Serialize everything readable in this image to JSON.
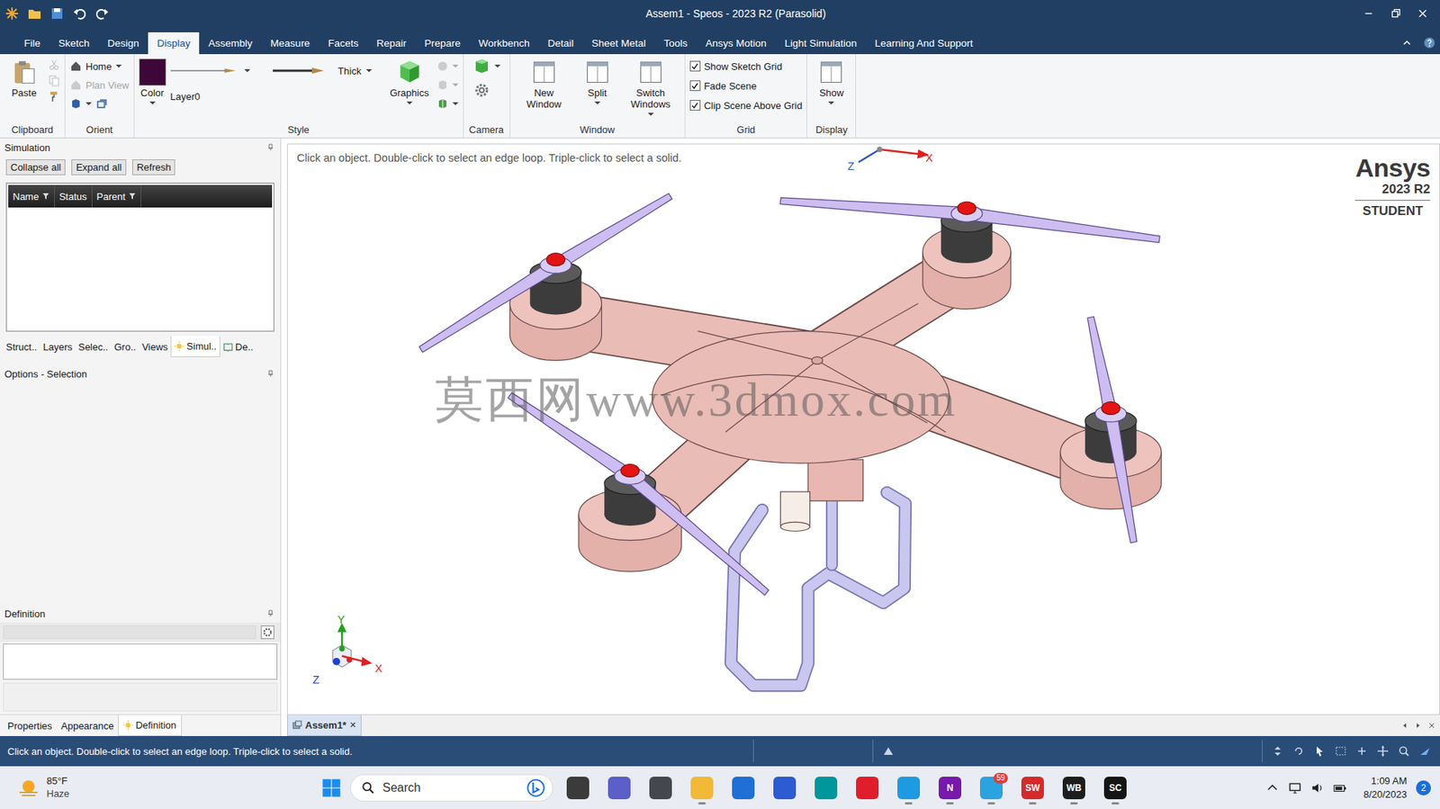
{
  "window": {
    "title": "Assem1 - Speos - 2023 R2 (Parasolid)"
  },
  "menu": [
    {
      "label": "File",
      "selected": false
    },
    {
      "label": "Sketch",
      "selected": false
    },
    {
      "label": "Design",
      "selected": false
    },
    {
      "label": "Display",
      "selected": true
    },
    {
      "label": "Assembly",
      "selected": false
    },
    {
      "label": "Measure",
      "selected": false
    },
    {
      "label": "Facets",
      "selected": false
    },
    {
      "label": "Repair",
      "selected": false
    },
    {
      "label": "Prepare",
      "selected": false
    },
    {
      "label": "Workbench",
      "selected": false
    },
    {
      "label": "Detail",
      "selected": false
    },
    {
      "label": "Sheet Metal",
      "selected": false
    },
    {
      "label": "Tools",
      "selected": false
    },
    {
      "label": "Ansys Motion",
      "selected": false
    },
    {
      "label": "Light Simulation",
      "selected": false
    },
    {
      "label": "Learning And Support",
      "selected": false
    }
  ],
  "ribbon": {
    "groups": [
      {
        "kind": "clipboard",
        "label": "Clipboard",
        "button": "Paste"
      },
      {
        "kind": "orient",
        "label": "Orient",
        "items": [
          {
            "label": "Home",
            "disabled": false
          },
          {
            "label": "Plan View",
            "disabled": true
          }
        ]
      },
      {
        "kind": "style",
        "label": "Style",
        "colorButton": "Color",
        "swatch": "#3d0838",
        "layer": "Layer0",
        "weight": "Thick",
        "graphics": "Graphics"
      },
      {
        "kind": "camera",
        "label": "Camera"
      },
      {
        "kind": "buttons",
        "label": "Window",
        "items": [
          {
            "label": "New Window",
            "dropdown": false
          },
          {
            "label": "Split",
            "dropdown": true
          },
          {
            "label": "Switch Windows",
            "dropdown": true
          }
        ]
      },
      {
        "kind": "checks",
        "label": "Grid",
        "items": [
          {
            "label": "Show Sketch Grid",
            "checked": true
          },
          {
            "label": "Fade Scene",
            "checked": true
          },
          {
            "label": "Clip Scene Above Grid",
            "checked": true
          }
        ]
      },
      {
        "kind": "buttons",
        "label": "Display",
        "items": [
          {
            "label": "Show",
            "dropdown": true
          }
        ]
      }
    ]
  },
  "simulationPanel": {
    "title": "Simulation",
    "buttons": [
      "Collapse all",
      "Expand all",
      "Refresh"
    ],
    "columns": [
      {
        "label": "Name",
        "filter": true
      },
      {
        "label": "Status",
        "filter": false
      },
      {
        "label": "Parent",
        "filter": true
      }
    ]
  },
  "panelTabs": [
    {
      "label": "Struct..",
      "selected": false
    },
    {
      "label": "Layers",
      "selected": false
    },
    {
      "label": "Selec..",
      "selected": false
    },
    {
      "label": "Gro..",
      "selected": false
    },
    {
      "label": "Views",
      "selected": false
    },
    {
      "label": "Simul..",
      "selected": true
    },
    {
      "label": "De..",
      "selected": false
    }
  ],
  "optionsPanel": {
    "title": "Options - Selection"
  },
  "definitionPanel": {
    "title": "Definition"
  },
  "bottomTabs": [
    {
      "label": "Properties",
      "selected": false
    },
    {
      "label": "Appearance",
      "selected": false
    },
    {
      "label": "Definition",
      "selected": true
    }
  ],
  "viewport": {
    "hint": "Click an object. Double-click to select an edge loop. Triple-click to select a solid.",
    "logo": {
      "brand": "Ansys",
      "version": "2023 R2",
      "edition": "STUDENT"
    },
    "watermark": "莫西网www.3dmox.com",
    "topTriad": {
      "z": "Z",
      "x": "X"
    },
    "bottomTriad": {
      "y": "Y",
      "x": "X",
      "z": "Z"
    }
  },
  "docTabs": [
    {
      "label": "Assem1*",
      "selected": true,
      "close": "✕"
    }
  ],
  "statusBar": {
    "text": "Click an object. Double-click to select an edge loop. Triple-click to select a solid."
  },
  "taskbar": {
    "weather": {
      "temp": "85°F",
      "condition": "Haze"
    },
    "search": "Search",
    "apps": [
      {
        "label": "",
        "color": "#3b3b3b",
        "badge": "",
        "active": false
      },
      {
        "label": "",
        "color": "#5b5fc7",
        "badge": "",
        "active": false
      },
      {
        "label": "",
        "color": "#44474d",
        "badge": "",
        "active": false
      },
      {
        "label": "",
        "color": "#f2b937",
        "badge": "",
        "active": true
      },
      {
        "label": "",
        "color": "#1f6fd6",
        "badge": "",
        "active": false
      },
      {
        "label": "",
        "color": "#2d5bd1",
        "badge": "",
        "active": false
      },
      {
        "label": "",
        "color": "#00979c",
        "badge": "",
        "active": false
      },
      {
        "label": "",
        "color": "#e01e2b",
        "badge": "",
        "active": false
      },
      {
        "label": "",
        "color": "#1e9be0",
        "badge": "",
        "active": true
      },
      {
        "label": "N",
        "color": "#7719aa",
        "badge": "",
        "active": true
      },
      {
        "label": "",
        "color": "#2aa3de",
        "badge": "59",
        "active": true
      },
      {
        "label": "SW",
        "color": "#d42a2a",
        "badge": "",
        "active": true
      },
      {
        "label": "WB",
        "color": "#1d1d1d",
        "badge": "",
        "active": true
      },
      {
        "label": "SC",
        "color": "#151515",
        "badge": "",
        "active": true
      }
    ],
    "clock": {
      "time": "1:09 AM",
      "date": "8/20/2023"
    },
    "notifications": "2"
  }
}
